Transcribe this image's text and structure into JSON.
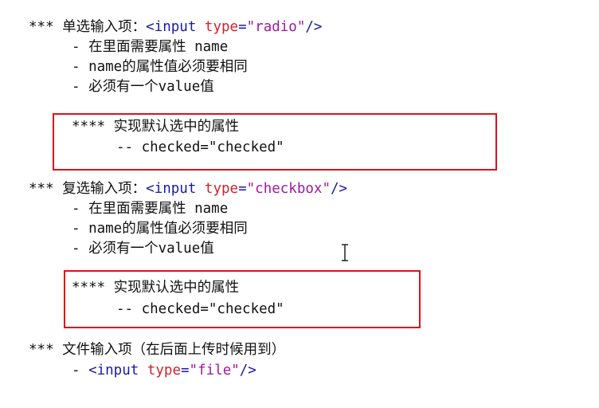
{
  "radio_section": {
    "heading_prefix": "*** 单选输入项：",
    "code": {
      "open": "<input ",
      "attr": "type",
      "eq": "=",
      "value": "\"radio\"",
      "close": "/>"
    },
    "bullets": [
      "- 在里面需要属性 name",
      "- name的属性值必须要相同",
      "- 必须有一个value值"
    ],
    "note": {
      "title": "**** 实现默认选中的属性",
      "detail": "-- checked=\"checked\""
    }
  },
  "checkbox_section": {
    "heading_prefix": "*** 复选输入项：",
    "code": {
      "open": "<input ",
      "attr": "type",
      "eq": "=",
      "value": "\"checkbox\"",
      "close": "/>"
    },
    "bullets": [
      "- 在里面需要属性 name",
      "- name的属性值必须要相同",
      "- 必须有一个value值"
    ],
    "note": {
      "title": "**** 实现默认选中的属性",
      "detail": "-- checked=\"checked\""
    }
  },
  "file_section": {
    "heading": "*** 文件输入项（在后面上传时候用到）",
    "bullet_prefix": "- ",
    "code": {
      "open": "<input ",
      "attr": "type",
      "eq": "=",
      "value": "\"file\"",
      "close": "/>"
    }
  },
  "colors": {
    "tag": "#1a1aa6",
    "attribute": "#d0232a",
    "string": "#a0199b",
    "highlight_box": "#e0101a"
  },
  "cursor_icon": "text-cursor-icon"
}
